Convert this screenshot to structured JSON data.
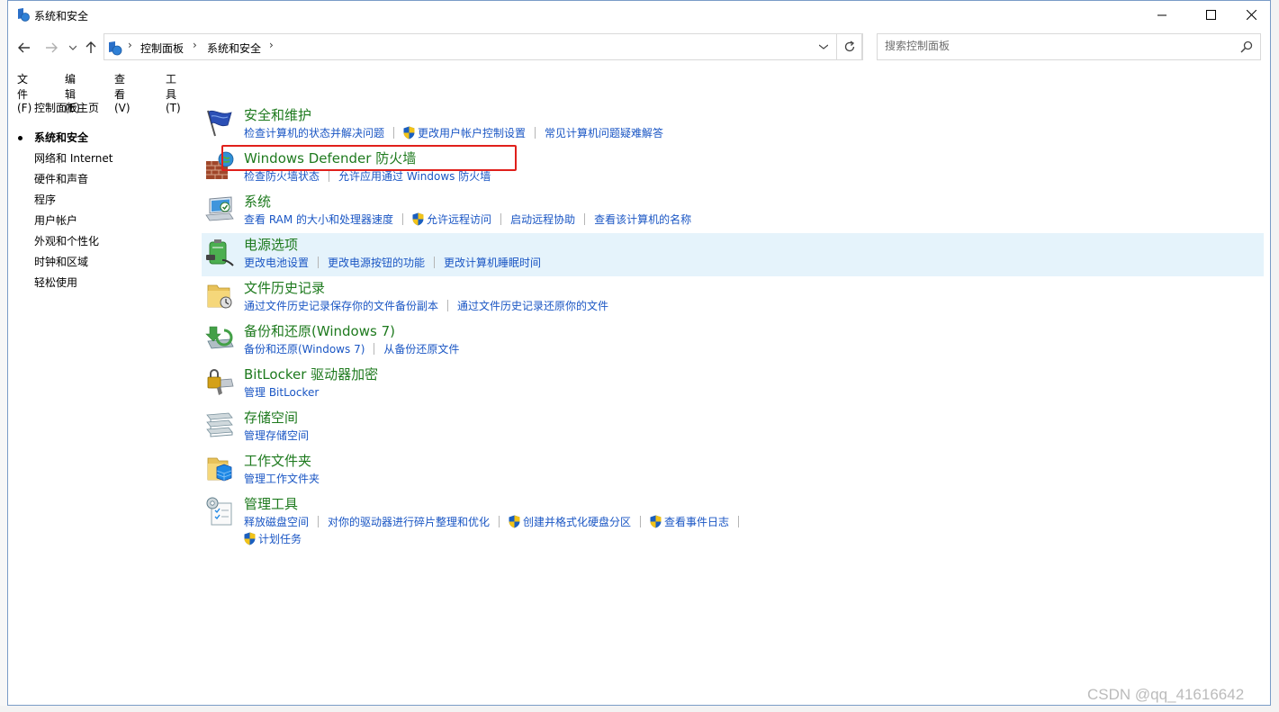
{
  "window": {
    "title": "系统和安全"
  },
  "address_bar": {
    "breadcrumbs": [
      "控制面板",
      "系统和安全"
    ],
    "separator": "›"
  },
  "search": {
    "placeholder": "搜索控制面板"
  },
  "menu": [
    "文件(F)",
    "编辑(E)",
    "查看(V)",
    "工具(T)"
  ],
  "sidebar": {
    "items": [
      {
        "label": "控制面板主页",
        "active": false
      },
      {
        "label": "系统和安全",
        "active": true
      },
      {
        "label": "网络和 Internet",
        "active": false
      },
      {
        "label": "硬件和声音",
        "active": false
      },
      {
        "label": "程序",
        "active": false
      },
      {
        "label": "用户帐户",
        "active": false
      },
      {
        "label": "外观和个性化",
        "active": false
      },
      {
        "label": "时钟和区域",
        "active": false
      },
      {
        "label": "轻松使用",
        "active": false
      }
    ]
  },
  "categories": [
    {
      "title": "安全和维护",
      "icon": "flag-icon",
      "links": [
        "检查计算机的状态并解决问题",
        "更改用户帐户控制设置",
        "常见计算机问题疑难解答"
      ],
      "shielded": [
        false,
        true,
        false
      ]
    },
    {
      "title": "Windows Defender 防火墙",
      "icon": "firewall-icon",
      "links": [
        "检查防火墙状态",
        "允许应用通过 Windows 防火墙"
      ],
      "shielded": [
        false,
        false
      ]
    },
    {
      "title": "系统",
      "icon": "computer-icon",
      "links": [
        "查看 RAM 的大小和处理器速度",
        "允许远程访问",
        "启动远程协助",
        "查看该计算机的名称"
      ],
      "shielded": [
        false,
        true,
        false,
        false
      ]
    },
    {
      "title": "电源选项",
      "icon": "power-icon",
      "links": [
        "更改电池设置",
        "更改电源按钮的功能",
        "更改计算机睡眠时间"
      ],
      "shielded": [
        false,
        false,
        false
      ],
      "highlighted": true
    },
    {
      "title": "文件历史记录",
      "icon": "file-history-icon",
      "links": [
        "通过文件历史记录保存你的文件备份副本",
        "通过文件历史记录还原你的文件"
      ],
      "shielded": [
        false,
        false
      ]
    },
    {
      "title": "备份和还原(Windows 7)",
      "icon": "backup-icon",
      "links": [
        "备份和还原(Windows 7)",
        "从备份还原文件"
      ],
      "shielded": [
        false,
        false
      ]
    },
    {
      "title": "BitLocker 驱动器加密",
      "icon": "bitlocker-icon",
      "links": [
        "管理 BitLocker"
      ],
      "shielded": [
        false
      ]
    },
    {
      "title": "存储空间",
      "icon": "storage-icon",
      "links": [
        "管理存储空间"
      ],
      "shielded": [
        false
      ]
    },
    {
      "title": "工作文件夹",
      "icon": "work-folders-icon",
      "links": [
        "管理工作文件夹"
      ],
      "shielded": [
        false
      ]
    },
    {
      "title": "管理工具",
      "icon": "admin-tools-icon",
      "links": [
        "释放磁盘空间",
        "对你的驱动器进行碎片整理和优化",
        "创建并格式化硬盘分区",
        "查看事件日志"
      ],
      "shielded": [
        false,
        false,
        true,
        true
      ],
      "links2": [
        "计划任务"
      ],
      "shielded2": [
        true
      ]
    }
  ],
  "watermark": "CSDN @qq_41616642",
  "colors": {
    "title_green": "#1e7a1e",
    "link_blue": "#1a56c4",
    "highlight": "#e5f3fb",
    "annotation_red": "#e0201b"
  }
}
